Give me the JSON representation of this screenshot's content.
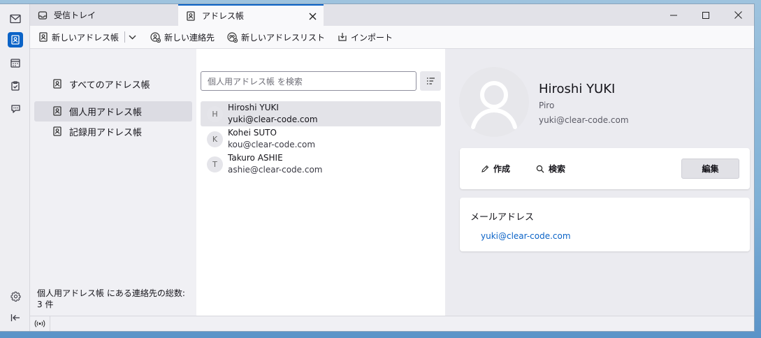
{
  "tabs": [
    {
      "label": "受信トレイ",
      "icon": "inbox-icon"
    },
    {
      "label": "アドレス帳",
      "icon": "address-book-icon",
      "active": true
    }
  ],
  "toolbar": {
    "new_address_book": "新しいアドレス帳",
    "new_contact": "新しい連絡先",
    "new_list": "新しいアドレスリスト",
    "import": "インポート"
  },
  "books": {
    "items": [
      {
        "label": "すべてのアドレス帳"
      },
      {
        "label": "個人用アドレス帳",
        "selected": true
      },
      {
        "label": "記録用アドレス帳"
      }
    ],
    "footer": "個人用アドレス帳 にある連絡先の総数: 3 件"
  },
  "list": {
    "search_placeholder": "個人用アドレス帳 を検索",
    "contacts": [
      {
        "initial": "H",
        "name": "Hiroshi YUKI",
        "email": "yuki@clear-code.com",
        "selected": true
      },
      {
        "initial": "K",
        "name": "Kohei SUTO",
        "email": "kou@clear-code.com"
      },
      {
        "initial": "T",
        "name": "Takuro ASHIE",
        "email": "ashie@clear-code.com"
      }
    ]
  },
  "detail": {
    "name": "Hiroshi YUKI",
    "nickname": "Piro",
    "email": "yuki@clear-code.com",
    "actions": {
      "compose": "作成",
      "search": "検索",
      "edit": "編集"
    },
    "email_section_title": "メールアドレス",
    "email_link": "yuki@clear-code.com"
  },
  "colors": {
    "accent": "#0b63c7",
    "link": "#0b63c7"
  }
}
